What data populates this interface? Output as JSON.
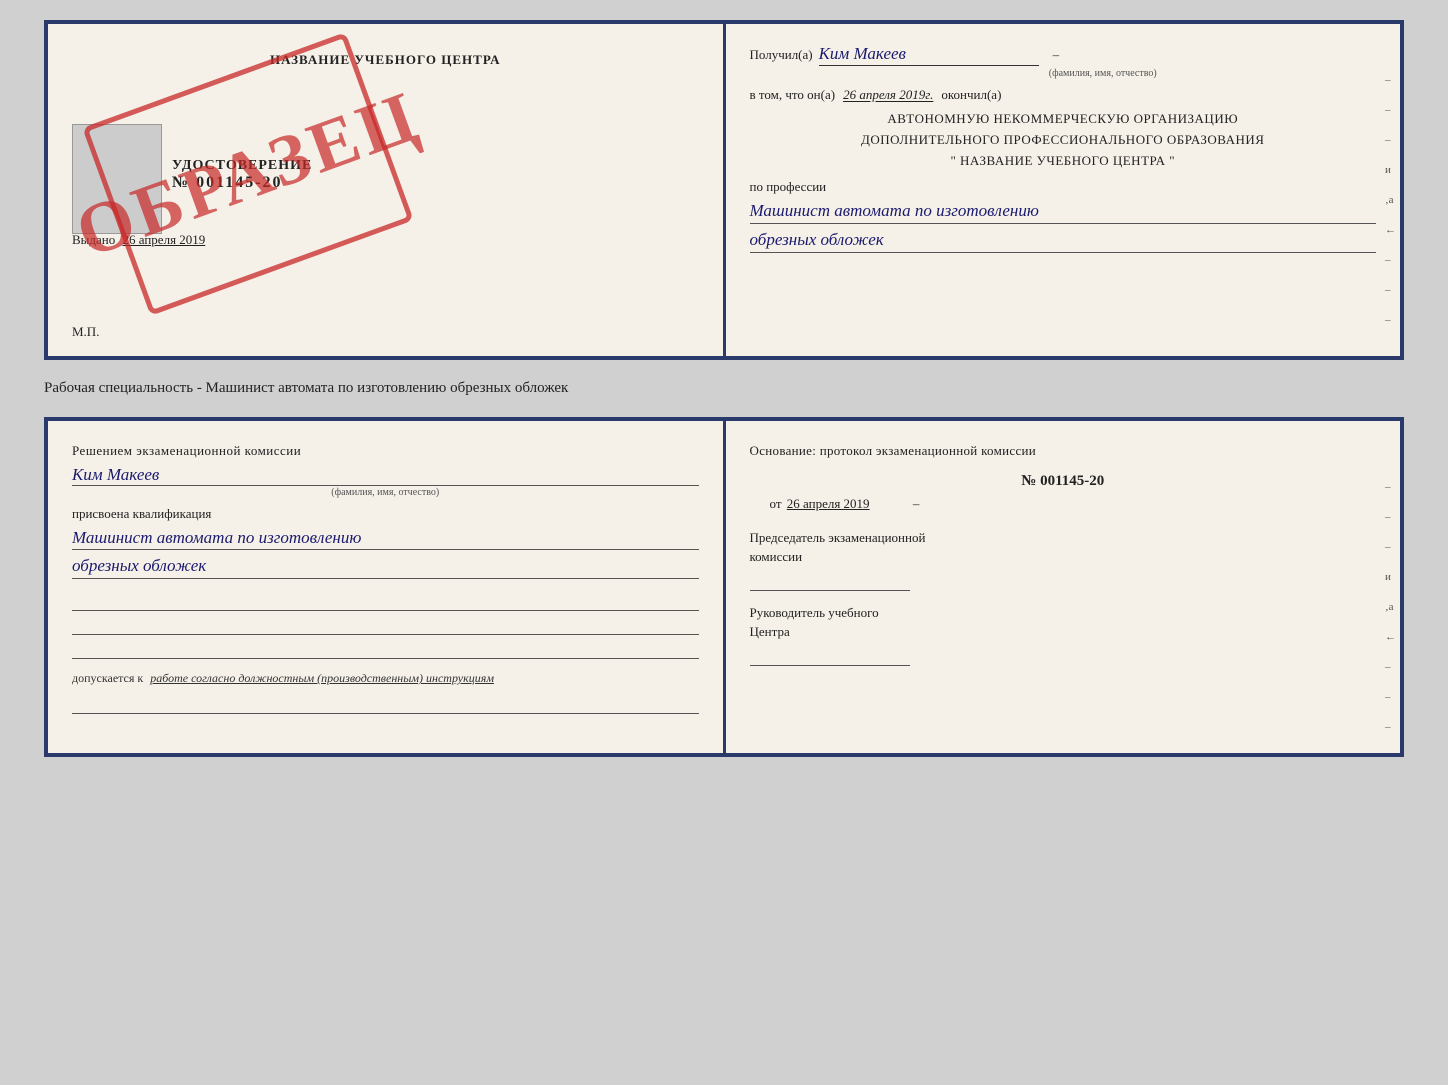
{
  "page": {
    "caption": "Рабочая специальность - Машинист автомата по изготовлению обрезных обложек"
  },
  "top_doc": {
    "left": {
      "title": "НАЗВАНИЕ УЧЕБНОГО ЦЕНТРА",
      "stamp_text": "ОБРАЗЕЦ",
      "udostoverenie": "УДОСТОВЕРЕНИЕ",
      "number": "№ 001145-20",
      "vydano_prefix": "Выдано",
      "vydano_date": "26 апреля 2019",
      "mp": "М.П."
    },
    "right": {
      "poluchil_label": "Получил(а)",
      "recipient_name": "Ким Макеев",
      "fio_hint": "(фамилия, имя, отчество)",
      "vtom_prefix": "в том, что он(а)",
      "vtom_date": "26 апреля 2019г.",
      "okончил": "окончил(а)",
      "org_line1": "АВТОНОМНУЮ НЕКОММЕРЧЕСКУЮ ОРГАНИЗАЦИЮ",
      "org_line2": "ДОПОЛНИТЕЛЬНОГО ПРОФЕССИОНАЛЬНОГО ОБРАЗОВАНИЯ",
      "org_line3": "\"  НАЗВАНИЕ УЧЕБНОГО ЦЕНТРА  \"",
      "po_professii": "по профессии",
      "profession_line1": "Машинист автомата по изготовлению",
      "profession_line2": "обрезных обложек",
      "side_marks": [
        "–",
        "–",
        "–",
        "и",
        "‚а",
        "←",
        "–",
        "–",
        "–"
      ]
    }
  },
  "bottom_doc": {
    "left": {
      "reshen_line1": "Решением  экзаменационной  комиссии",
      "reshen_name": "Ким Макеев",
      "fio_hint": "(фамилия, имя, отчество)",
      "prisv_label": "присвоена квалификация",
      "profession_line1": "Машинист автомата по изготовлению",
      "profession_line2": "обрезных обложек",
      "dopusk_prefix": "допускается к",
      "dopusk_text": "работе согласно должностным (производственным) инструкциям"
    },
    "right": {
      "osnovanie": "Основание: протокол экзаменационной  комиссии",
      "protocol_number": "№  001145-20",
      "protocol_date_prefix": "от",
      "protocol_date": "26 апреля 2019",
      "predsedatel_label": "Председатель экзаменационной",
      "komissii_label": "комиссии",
      "rukovoditel_label": "Руководитель учебного",
      "tsentra_label": "Центра",
      "side_marks": [
        "–",
        "–",
        "–",
        "и",
        "‚а",
        "←",
        "–",
        "–",
        "–"
      ]
    }
  }
}
